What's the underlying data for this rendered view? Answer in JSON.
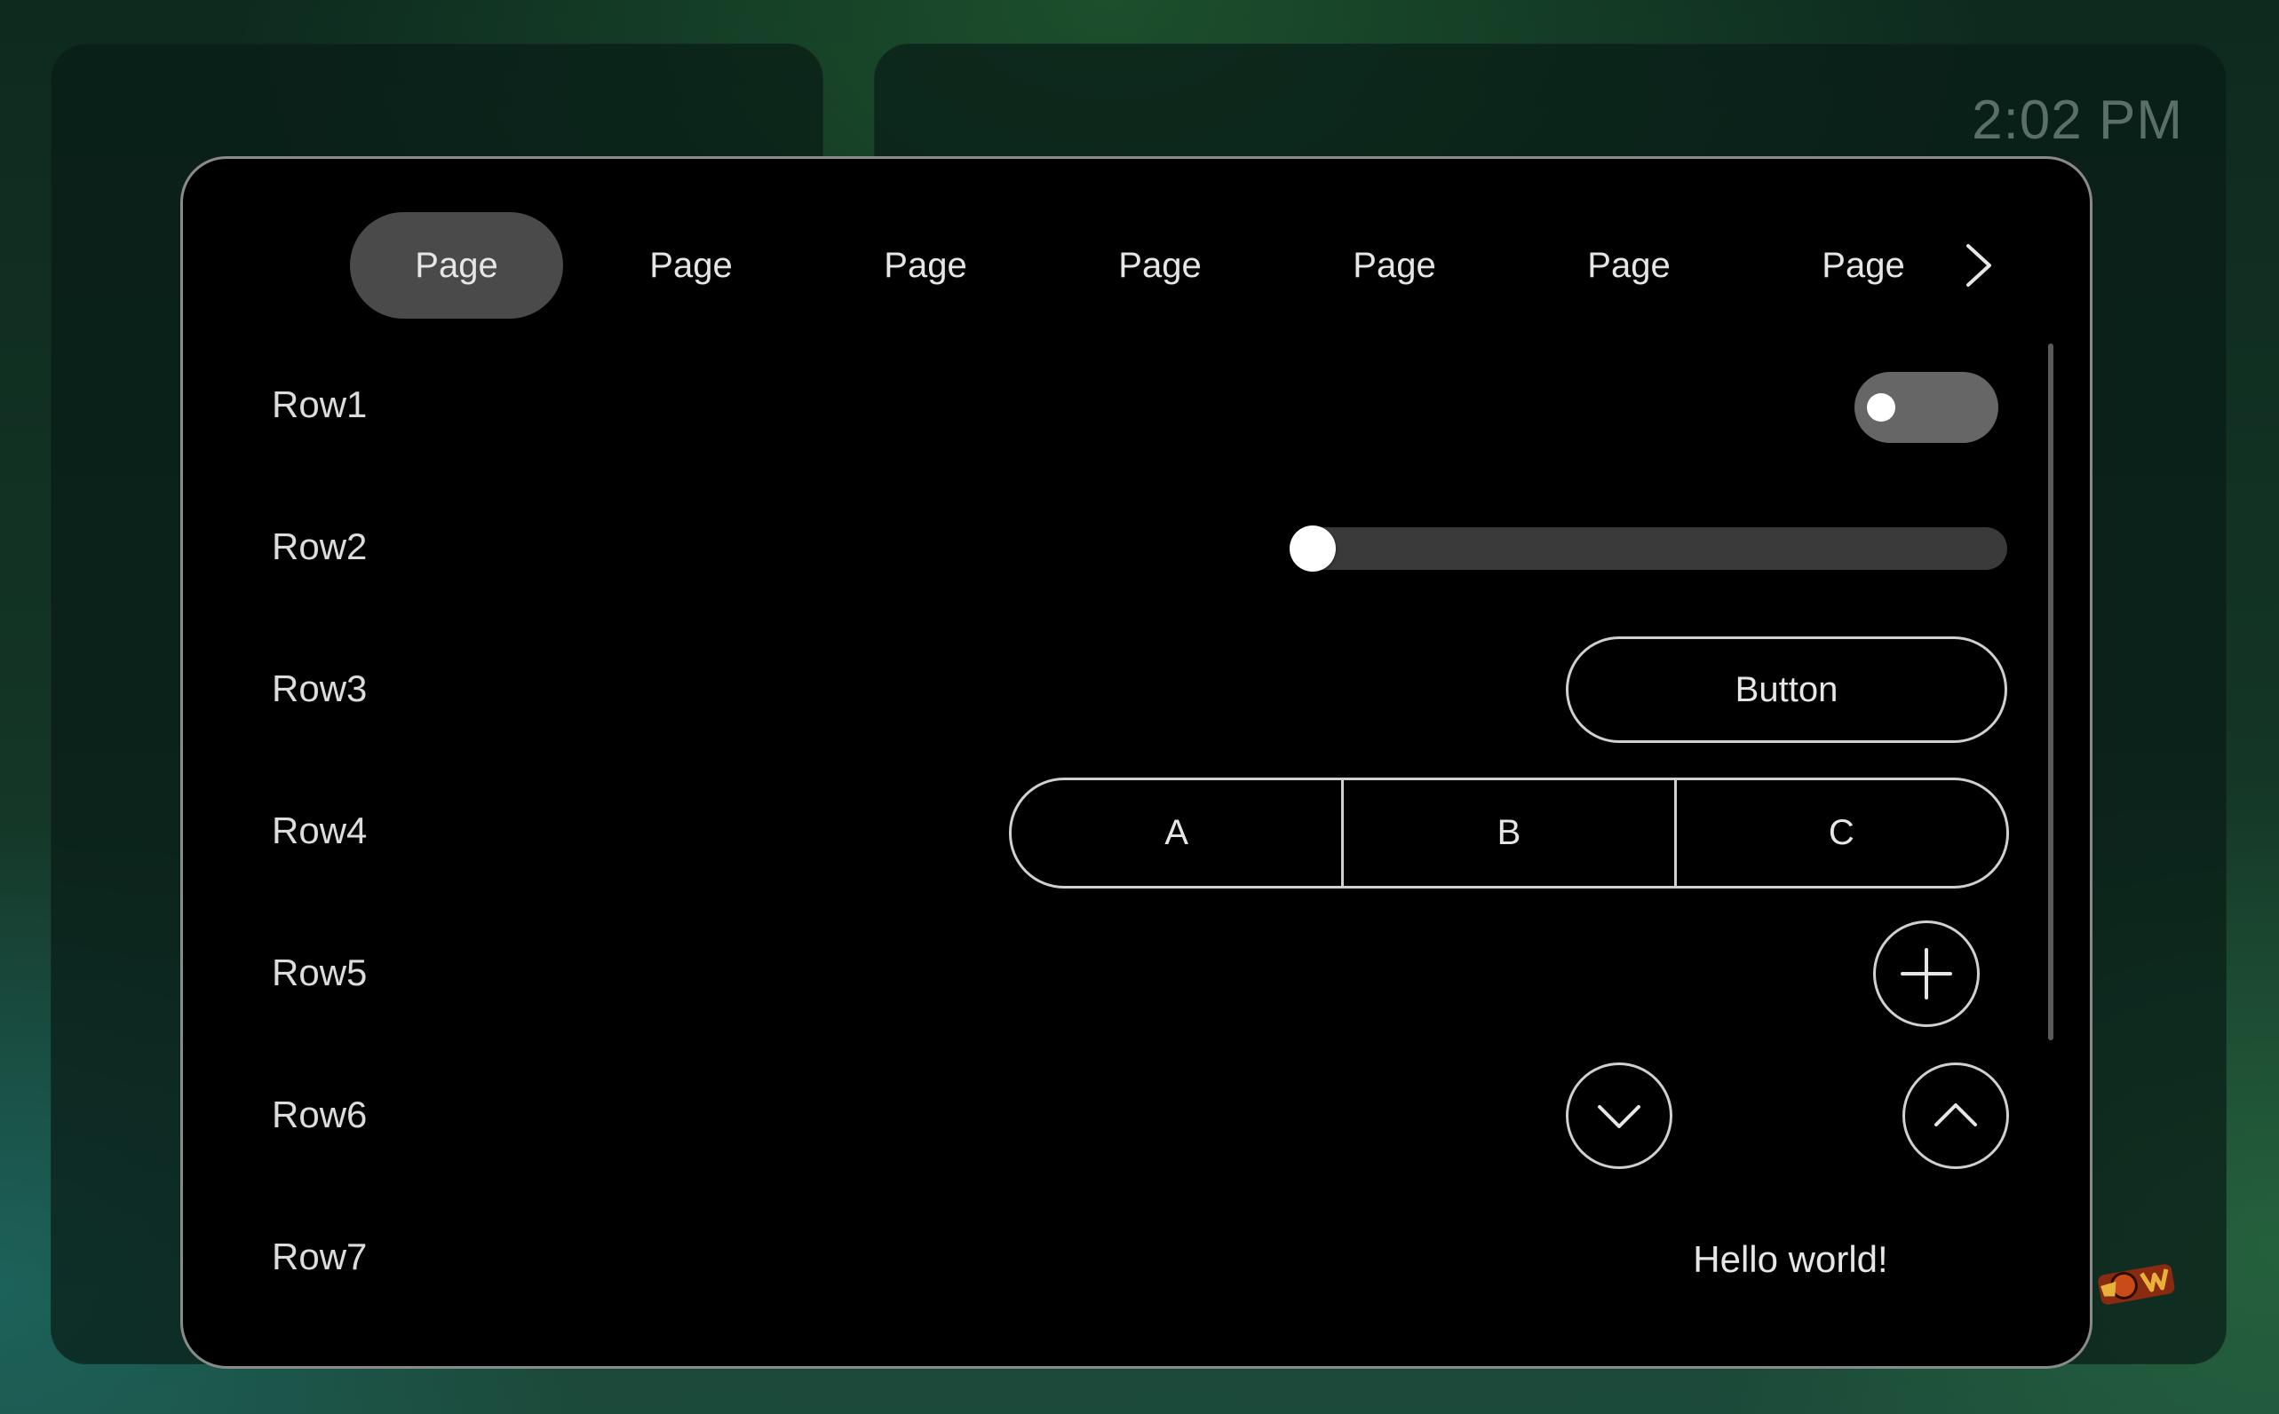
{
  "background": {
    "clock": "2:02 PM"
  },
  "tabs": {
    "items": [
      "Page",
      "Page",
      "Page",
      "Page",
      "Page",
      "Page",
      "Page"
    ],
    "active_index": 0,
    "next_icon": "chevron-right-icon"
  },
  "rows": [
    {
      "label": "Row1",
      "control": "toggle",
      "on": false
    },
    {
      "label": "Row2",
      "control": "slider",
      "value": 0
    },
    {
      "label": "Row3",
      "control": "button",
      "button_label": "Button"
    },
    {
      "label": "Row4",
      "control": "segmented",
      "segments": [
        "A",
        "B",
        "C"
      ]
    },
    {
      "label": "Row5",
      "control": "icon-button",
      "icon": "plus-icon"
    },
    {
      "label": "Row6",
      "control": "spinner-buttons",
      "icons": [
        "chevron-down-icon",
        "chevron-up-icon"
      ]
    },
    {
      "label": "Row7",
      "control": "text",
      "text": "Hello world!"
    }
  ],
  "colors": {
    "panel_bg": "#000000",
    "border": "#8a8a8a",
    "active_tab": "#4a4a4a",
    "text": "#e6e6e6"
  }
}
